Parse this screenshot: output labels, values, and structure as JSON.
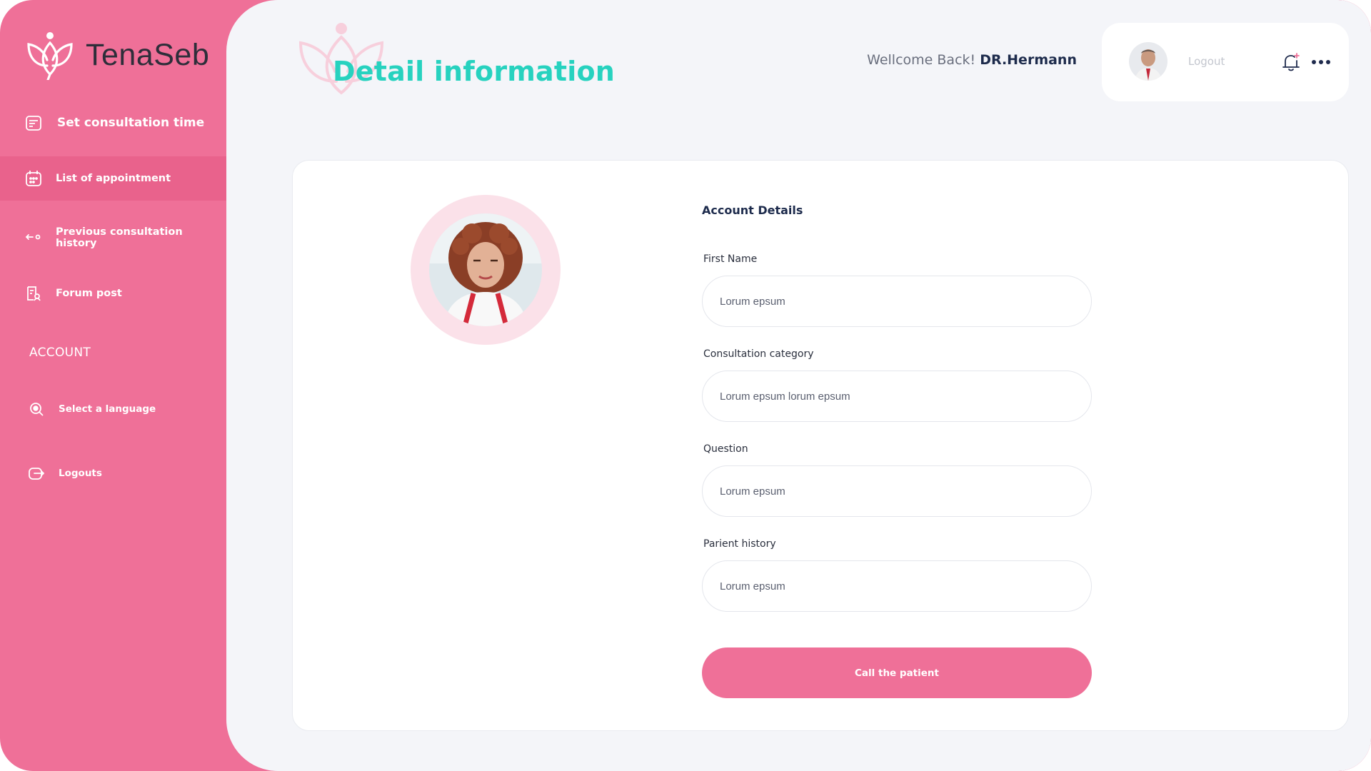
{
  "brand": {
    "name": "TenaSeb"
  },
  "colors": {
    "accent": "#ef7098",
    "title": "#27d2bf",
    "navy": "#1d2b4c"
  },
  "sidebar": {
    "items": [
      {
        "label": "Set consultation time",
        "icon": "schedule-icon"
      },
      {
        "label": "List of appointment",
        "icon": "calendar-icon"
      },
      {
        "label": "Previous consultation history",
        "icon": "history-arrows-icon"
      },
      {
        "label": "Forum post",
        "icon": "forum-post-icon"
      }
    ],
    "account_heading": "ACCOUNT",
    "account_items": [
      {
        "label": "Select a language",
        "icon": "language-search-icon"
      },
      {
        "label": "Logouts",
        "icon": "logout-icon"
      }
    ]
  },
  "header": {
    "title": "Detail information",
    "welcome_prefix": "Wellcome Back!",
    "welcome_name": "DR.Hermann",
    "logout_label": "Logout"
  },
  "form": {
    "section_title": "Account Details",
    "fields": [
      {
        "label": "First Name",
        "value": "Lorum epsum"
      },
      {
        "label": "Consultation category",
        "value": "Lorum epsum lorum epsum"
      },
      {
        "label": "Question",
        "value": "Lorum epsum"
      },
      {
        "label": "Parient history",
        "value": "Lorum epsum"
      }
    ],
    "submit_label": "Call the patient"
  }
}
